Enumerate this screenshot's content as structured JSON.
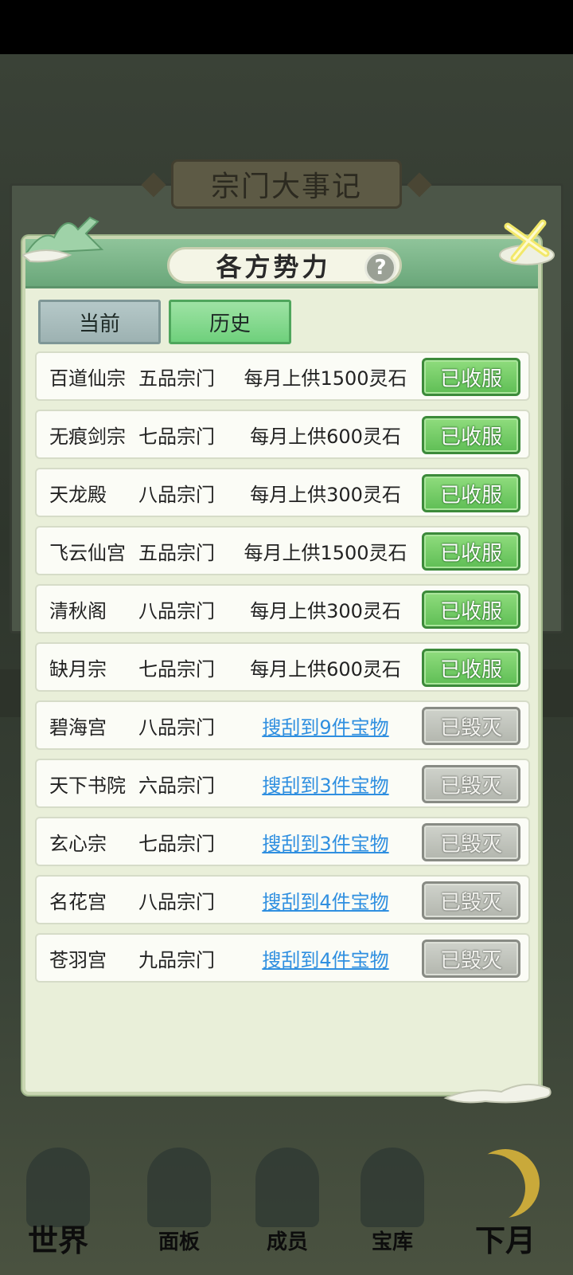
{
  "background": {
    "banner_title": "宗门大事记"
  },
  "modal": {
    "title": "各方势力",
    "help_symbol": "?",
    "tabs": [
      {
        "label": "当前",
        "selected": false
      },
      {
        "label": "历史",
        "selected": true
      }
    ],
    "rows": [
      {
        "name": "百道仙宗",
        "grade": "五品宗门",
        "info": "每月上供1500灵石",
        "status": "已收服",
        "state": "subdued"
      },
      {
        "name": "无痕剑宗",
        "grade": "七品宗门",
        "info": "每月上供600灵石",
        "status": "已收服",
        "state": "subdued"
      },
      {
        "name": "天龙殿",
        "grade": "八品宗门",
        "info": "每月上供300灵石",
        "status": "已收服",
        "state": "subdued"
      },
      {
        "name": "飞云仙宫",
        "grade": "五品宗门",
        "info": "每月上供1500灵石",
        "status": "已收服",
        "state": "subdued"
      },
      {
        "name": "清秋阁",
        "grade": "八品宗门",
        "info": "每月上供300灵石",
        "status": "已收服",
        "state": "subdued"
      },
      {
        "name": "缺月宗",
        "grade": "七品宗门",
        "info": "每月上供600灵石",
        "status": "已收服",
        "state": "subdued"
      },
      {
        "name": "碧海宫",
        "grade": "八品宗门",
        "info": "搜刮到9件宝物",
        "status": "已毁灭",
        "state": "destroyed"
      },
      {
        "name": "天下书院",
        "grade": "六品宗门",
        "info": "搜刮到3件宝物",
        "status": "已毁灭",
        "state": "destroyed"
      },
      {
        "name": "玄心宗",
        "grade": "七品宗门",
        "info": "搜刮到3件宝物",
        "status": "已毁灭",
        "state": "destroyed"
      },
      {
        "name": "名花宫",
        "grade": "八品宗门",
        "info": "搜刮到4件宝物",
        "status": "已毁灭",
        "state": "destroyed"
      },
      {
        "name": "苍羽宫",
        "grade": "九品宗门",
        "info": "搜刮到4件宝物",
        "status": "已毁灭",
        "state": "destroyed"
      }
    ]
  },
  "bottom_nav": [
    {
      "label": "世界",
      "icon": "palace-icon"
    },
    {
      "label": "面板",
      "icon": "gate-icon"
    },
    {
      "label": "成员",
      "icon": "disciple-icon"
    },
    {
      "label": "宝库",
      "icon": "treasury-icon"
    },
    {
      "label": "下月",
      "icon": "moon-icon"
    }
  ],
  "colors": {
    "accent_green": "#6aa77a",
    "subdued_button": "#5fbe55",
    "destroyed_button": "#b3b6ae",
    "link_blue": "#2f8fe0"
  }
}
